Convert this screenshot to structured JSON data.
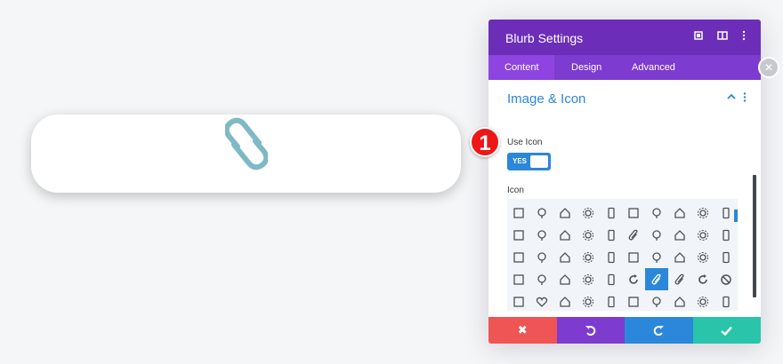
{
  "panel": {
    "title": "Blurb Settings",
    "tabs": [
      {
        "label": "Content",
        "active": true
      },
      {
        "label": "Design",
        "active": false
      },
      {
        "label": "Advanced",
        "active": false
      }
    ],
    "section_title": "Image & Icon",
    "use_icon_label": "Use Icon",
    "toggle_value": "YES",
    "icon_label": "Icon",
    "footer_colors": {
      "cancel": "#ef5555",
      "undo": "#7e3bd0",
      "redo": "#2b87da",
      "save": "#29c4a9"
    }
  },
  "badge": {
    "number": "1"
  },
  "colors": {
    "accent": "#2b87da",
    "header": "#6c2eb9",
    "icon_teal": "#7fb9c5"
  },
  "icons": [
    "bar-chart-icon",
    "lightbulb-icon",
    "home-icon",
    "gear-icon",
    "phone-icon",
    "tablet-icon",
    "laptop-icon",
    "monitor-icon",
    "graduation-cap-icon",
    "envelope-icon",
    "triangle-stack-icon",
    "bookmark-icon",
    "clipboard-icon",
    "credit-card-icon",
    "cart-icon",
    "paperclip-icon",
    "tag-icon",
    "tag-alt-icon",
    "trash-icon",
    "cursor-icon",
    "microphone-icon",
    "compass-icon",
    "map-pin-icon",
    "pushpin-icon",
    "book-icon",
    "inbox-icon",
    "briefcase-icon",
    "drawer-icon",
    "calendar-icon",
    "film-icon",
    "table-icon",
    "document-icon",
    "headphones-icon",
    "life-ring-icon",
    "pie-chart-icon",
    "refresh-icon",
    "paperclip-selected-icon",
    "link-icon",
    "loading-icon",
    "block-icon",
    "archive-icon",
    "heart-icon",
    "printer-icon",
    "building-icon",
    "city-icon",
    "save-icon",
    "laptop-alt-icon",
    "magnify-doc-icon",
    "id-card-icon",
    "clipboard-alt-icon"
  ],
  "selected_icon": "paperclip-selected-icon"
}
